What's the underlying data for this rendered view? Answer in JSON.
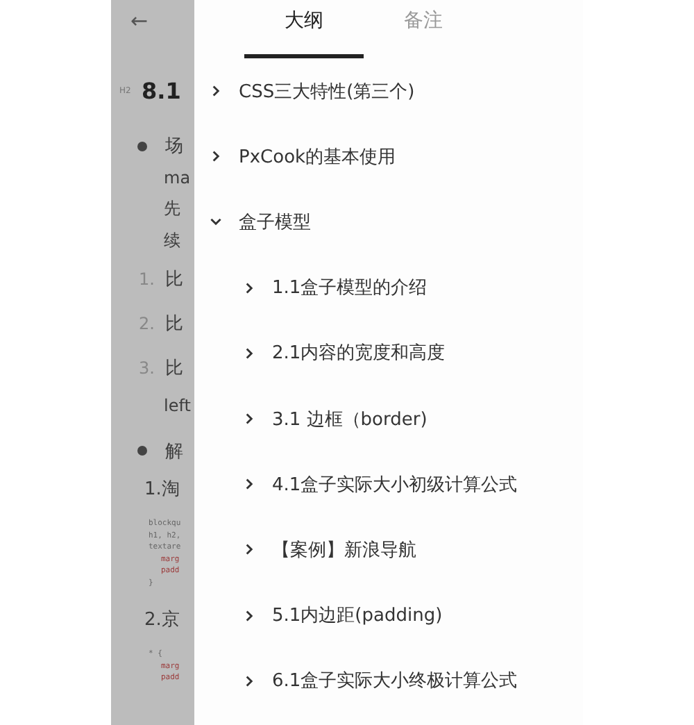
{
  "document": {
    "back": "←",
    "rows": [
      {
        "kind": "heading",
        "tag": "H2",
        "text": "8.1"
      },
      {
        "kind": "bullet",
        "text": "场"
      },
      {
        "kind": "text",
        "text": "ma"
      },
      {
        "kind": "text",
        "text": "先"
      },
      {
        "kind": "text",
        "text": "续"
      },
      {
        "kind": "numbered",
        "num": "1.",
        "text": "比"
      },
      {
        "kind": "numbered",
        "num": "2.",
        "text": "比"
      },
      {
        "kind": "numbered",
        "num": "3.",
        "text": "比"
      },
      {
        "kind": "text",
        "text": "left"
      },
      {
        "kind": "bullet",
        "text": "解"
      },
      {
        "kind": "subheading",
        "text": "1.淘"
      },
      {
        "kind": "code",
        "lines": [
          {
            "kind": "plain",
            "text": "blockqu"
          },
          {
            "kind": "plain",
            "text": "h1, h2,"
          },
          {
            "kind": "plain",
            "text": "textare"
          },
          {
            "kind": "prop",
            "text": "marg"
          },
          {
            "kind": "prop",
            "text": "padd"
          },
          {
            "kind": "plain",
            "text": "}"
          }
        ]
      },
      {
        "kind": "subheading",
        "text": "2.京"
      },
      {
        "kind": "code",
        "lines": [
          {
            "kind": "plain",
            "text": "* {"
          },
          {
            "kind": "prop",
            "text": "marg"
          },
          {
            "kind": "prop",
            "text": "padd"
          }
        ]
      }
    ]
  },
  "drawer": {
    "tabs": [
      {
        "label": "大纲",
        "selected": true
      },
      {
        "label": "备注",
        "selected": false
      }
    ],
    "outline": [
      {
        "title": "CSS三大特性(第三个)",
        "expanded": false
      },
      {
        "title": "PxCook的基本使用",
        "expanded": false
      },
      {
        "title": "盒子模型",
        "expanded": true,
        "children": [
          {
            "title": "1.1盒子模型的介绍",
            "expanded": false
          },
          {
            "title": "2.1内容的宽度和高度",
            "expanded": false
          },
          {
            "title": "3.1 边框（border)",
            "expanded": false
          },
          {
            "title": "4.1盒子实际大小初级计算公式",
            "expanded": false
          },
          {
            "title": "【案例】新浪导航",
            "expanded": false
          },
          {
            "title": "5.1内边距(padding)",
            "expanded": false
          },
          {
            "title": "6.1盒子实际大小终极计算公式",
            "expanded": false
          }
        ]
      }
    ]
  }
}
